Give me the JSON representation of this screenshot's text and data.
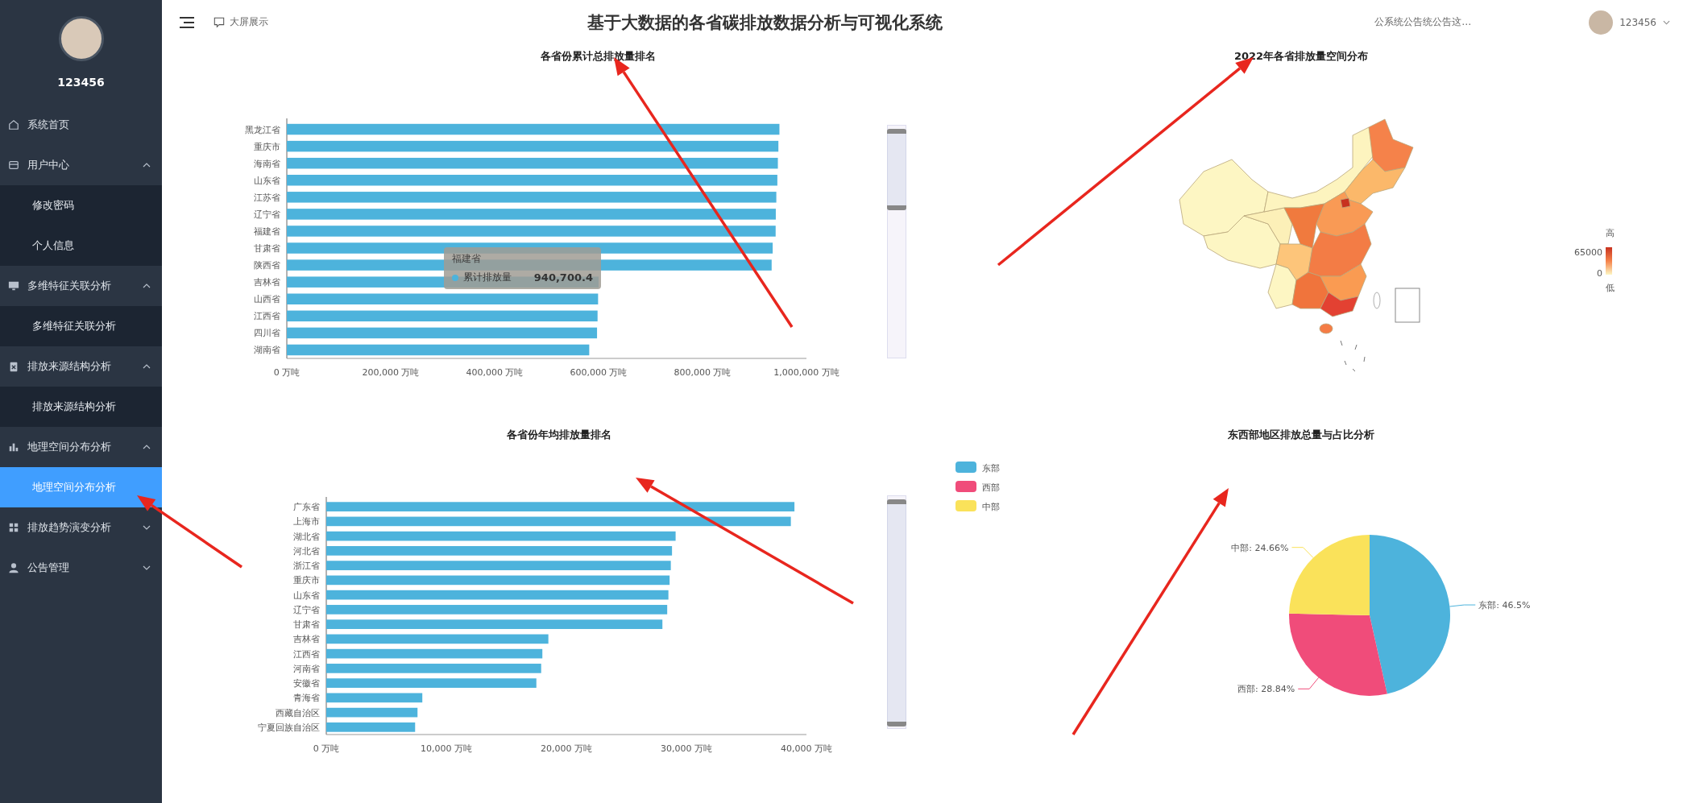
{
  "sidebar": {
    "user": {
      "name": "123456"
    },
    "menu": [
      {
        "label": "系统首页"
      },
      {
        "label": "用户中心",
        "expanded": true,
        "children": [
          {
            "label": "修改密码",
            "selected": false
          },
          {
            "label": "个人信息",
            "selected": false
          }
        ]
      },
      {
        "label": "多维特征关联分析",
        "expanded": true,
        "children": [
          {
            "label": "多维特征关联分析",
            "selected": false
          }
        ]
      },
      {
        "label": "排放来源结构分析",
        "expanded": true,
        "children": [
          {
            "label": "排放来源结构分析",
            "selected": false
          }
        ]
      },
      {
        "label": "地理空间分布分析",
        "expanded": true,
        "children": [
          {
            "label": "地理空间分布分析",
            "selected": true
          }
        ]
      },
      {
        "label": "排放趋势演变分析",
        "expanded": false
      },
      {
        "label": "公告管理",
        "expanded": false
      }
    ]
  },
  "header": {
    "screen_link": "大屏展示",
    "title": "基于大数据的各省碳排放数据分析与可视化系统",
    "notice": "公系统公告统公告这…",
    "user": "123456"
  },
  "panels": {
    "cumulative": {
      "chart_data": {
        "type": "bar",
        "orientation": "horizontal",
        "title": "各省份累计总排放量排名",
        "categories": [
          "黑龙江省",
          "重庆市",
          "海南省",
          "山东省",
          "江苏省",
          "辽宁省",
          "福建省",
          "甘肃省",
          "陕西省",
          "吉林省",
          "山西省",
          "江西省",
          "四川省",
          "湖南省"
        ],
        "series": [
          {
            "name": "累计排放量",
            "color": "#4db3dc",
            "values": [
              948000,
              946000,
              945000,
              944000,
              942000,
              941000,
              940700,
              935000,
              933000,
              600000,
              599000,
              598000,
              597000,
              582000
            ]
          }
        ],
        "xlim": [
          0,
          1000000
        ],
        "xticks": [
          {
            "value": 0,
            "label": "0 万吨"
          },
          {
            "value": 200000,
            "label": "200,000 万吨"
          },
          {
            "value": 400000,
            "label": "400,000 万吨"
          },
          {
            "value": 600000,
            "label": "600,000 万吨"
          },
          {
            "value": 800000,
            "label": "800,000 万吨"
          },
          {
            "value": 1000000,
            "label": "1,000,000 万吨"
          }
        ]
      },
      "tooltip": {
        "title": "福建省",
        "value": "940,700.4"
      },
      "zoom": {
        "level": 0.35
      }
    },
    "map": {
      "title": "2022年各省排放量空间分布",
      "legend": {
        "high": "高",
        "max": "65000",
        "min": "0",
        "low": "低"
      }
    },
    "annual": {
      "chart_data": {
        "type": "bar",
        "orientation": "horizontal",
        "title": "各省份年均排放量排名",
        "categories": [
          "广东省",
          "上海市",
          "湖北省",
          "河北省",
          "浙江省",
          "重庆市",
          "山东省",
          "辽宁省",
          "甘肃省",
          "吉林省",
          "江西省",
          "河南省",
          "安徽省",
          "青海省",
          "西藏自治区",
          "宁夏回族自治区"
        ],
        "series": [
          {
            "color": "#4db3dc",
            "values": [
              39000,
              38700,
              29100,
              28800,
              28700,
              28600,
              28500,
              28400,
              28000,
              18500,
              18000,
              17900,
              17500,
              8000,
              7600,
              7400
            ]
          }
        ],
        "xlim": [
          0,
          40000
        ],
        "xticks": [
          {
            "value": 0,
            "label": "0 万吨"
          },
          {
            "value": 10000,
            "label": "10,000 万吨"
          },
          {
            "value": 20000,
            "label": "20,000 万吨"
          },
          {
            "value": 30000,
            "label": "30,000 万吨"
          },
          {
            "value": 40000,
            "label": "40,000 万吨"
          }
        ]
      },
      "zoom": {
        "level": 0.98
      }
    },
    "regions": {
      "chart_data": {
        "type": "pie",
        "title": "东西部地区排放总量与占比分析",
        "categories": [
          "东部",
          "西部",
          "中部"
        ],
        "legend": true,
        "series": [
          {
            "values": [
              46.5,
              28.84,
              24.66
            ],
            "colors": [
              "#4db3dc",
              "#f04c7a",
              "#fae25a"
            ]
          }
        ],
        "value_labels": [
          "东部: 46.5%",
          "西部: 28.84%",
          "中部: 24.66%"
        ]
      }
    }
  }
}
